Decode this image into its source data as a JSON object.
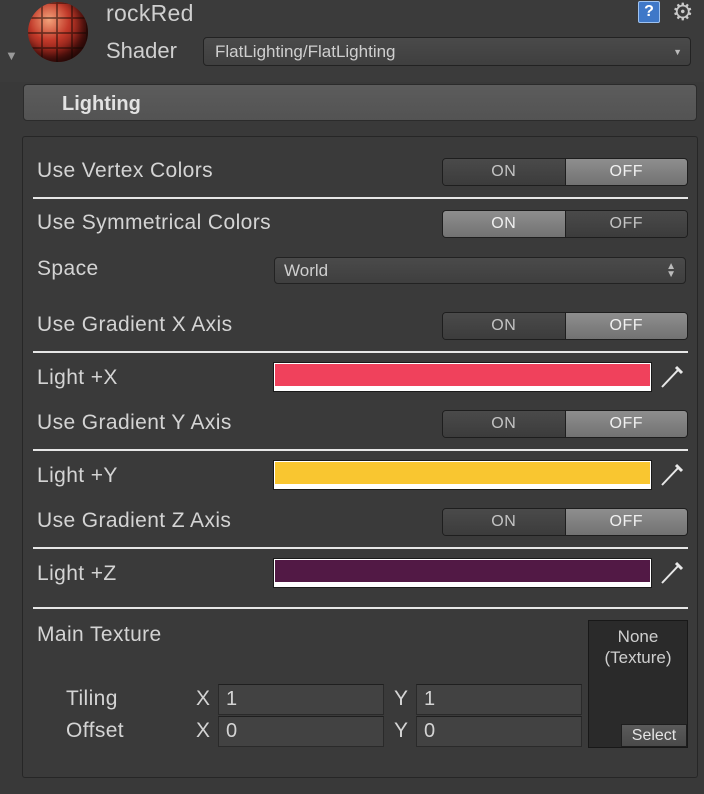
{
  "header": {
    "material_name": "rockRed",
    "shader_label": "Shader",
    "shader_value": "FlatLighting/FlatLighting",
    "help_glyph": "?",
    "icons": [
      "material-preview-icon",
      "help-icon",
      "gear-icon",
      "foldout-icon"
    ]
  },
  "section": {
    "title": "Lighting"
  },
  "properties": {
    "use_vertex_colors": {
      "label": "Use Vertex Colors",
      "on": "ON",
      "off": "OFF",
      "selected": "OFF"
    },
    "use_symmetrical_colors": {
      "label": "Use Symmetrical Colors",
      "on": "ON",
      "off": "OFF",
      "selected": "ON"
    },
    "space": {
      "label": "Space",
      "value": "World"
    },
    "use_gradient_x": {
      "label": "Use Gradient X Axis",
      "on": "ON",
      "off": "OFF",
      "selected": "OFF"
    },
    "light_x": {
      "label": "Light +X",
      "color": "#f0415c"
    },
    "use_gradient_y": {
      "label": "Use Gradient Y Axis",
      "on": "ON",
      "off": "OFF",
      "selected": "OFF"
    },
    "light_y": {
      "label": "Light +Y",
      "color": "#f9c630"
    },
    "use_gradient_z": {
      "label": "Use Gradient Z Axis",
      "on": "ON",
      "off": "OFF",
      "selected": "OFF"
    },
    "light_z": {
      "label": "Light +Z",
      "color": "#521945"
    },
    "main_texture": {
      "label": "Main Texture",
      "slot_line1": "None",
      "slot_line2": "(Texture)",
      "select_label": "Select",
      "tiling_label": "Tiling",
      "offset_label": "Offset",
      "x_label": "X",
      "y_label": "Y",
      "tiling_x": "1",
      "tiling_y": "1",
      "offset_x": "0",
      "offset_y": "0"
    }
  },
  "colors": {
    "background": "#393939",
    "toggle_active": "#7f7f7f",
    "separator": "#e6e6e6"
  }
}
